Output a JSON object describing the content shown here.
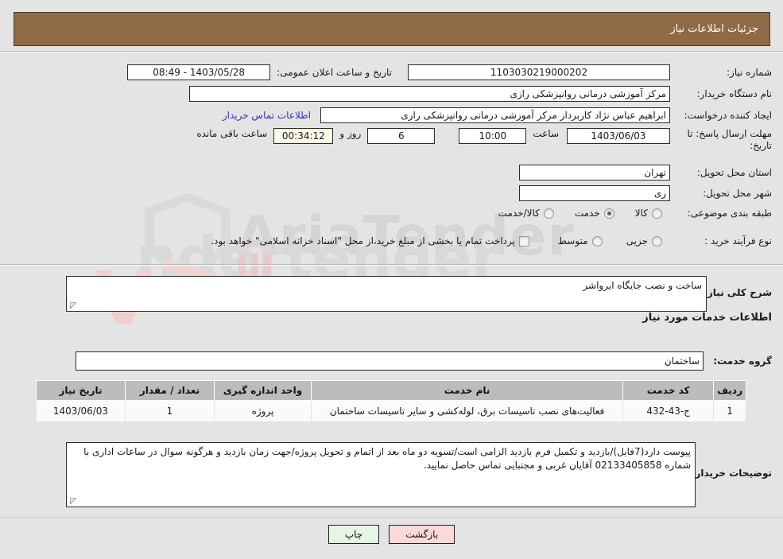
{
  "header": {
    "title": "جزئیات اطلاعات نیاز"
  },
  "watermark": {
    "brand": "AriaTender",
    "tld": ".net",
    "lower": "ndertender"
  },
  "form": {
    "need_number": {
      "label": "شماره نیاز:",
      "value": "1103030219000202"
    },
    "announce_datetime": {
      "label": "تاریخ و ساعت اعلان عمومی:",
      "value": "1403/05/28 - 08:49"
    },
    "buyer_org": {
      "label": "نام دستگاه خریدار:",
      "value": "مرکز آموزشی درمانی روانپزشکی رازی"
    },
    "request_creator": {
      "label": "ایجاد کننده درخواست:",
      "value": "ابراهیم عباس نژاد کاربرداز مرکز آموزشی درمانی روانپزشکی رازی"
    },
    "buyer_contact_link": "اطلاعات تماس خریدار",
    "deadline": {
      "label_line1": "مهلت ارسال پاسخ: تا",
      "label_line2": "تاریخ:",
      "date": "1403/06/03",
      "time_label": "ساعت",
      "time": "10:00",
      "days": "6",
      "days_label": "روز و",
      "countdown": "00:34:12",
      "remaining_label": "ساعت باقی مانده"
    },
    "delivery_province": {
      "label": "استان محل تحویل:",
      "value": "تهران"
    },
    "delivery_city": {
      "label": "شهر محل تحویل:",
      "value": "ری"
    },
    "category": {
      "label": "طبقه بندی موضوعی:",
      "options": [
        "کالا",
        "خدمت",
        "کالا/خدمت"
      ],
      "selected": "خدمت"
    },
    "purchase_type": {
      "label": "نوع فرآیند خرید :",
      "options": [
        "جزیی",
        "متوسط"
      ],
      "selected": ""
    },
    "treasury_note": {
      "text": "پرداخت تمام یا بخشی از مبلغ خرید،از محل \"اسناد خزانه اسلامی\" خواهد بود.",
      "checked": false
    }
  },
  "description": {
    "label": "شرح کلی نیاز:",
    "value": "ساخت و نصب جایگاه ایرواشر"
  },
  "services_section": {
    "heading": "اطلاعات خدمات مورد نیاز",
    "service_group": {
      "label": "گروه خدمت:",
      "value": "ساختمان"
    },
    "table": {
      "columns": [
        "ردیف",
        "کد خدمت",
        "نام خدمت",
        "واحد اندازه گیری",
        "تعداد / مقدار",
        "تاریخ نیاز"
      ],
      "rows": [
        {
          "index": "1",
          "code": "ج-43-432",
          "name": "فعالیت‌های نصب تاسیسات برق، لوله‌کشی و سایر تاسیسات ساختمان",
          "unit": "پروژه",
          "quantity": "1",
          "need_date": "1403/06/03"
        }
      ]
    }
  },
  "buyer_notes": {
    "label": "توضیحات خریدار:",
    "value": "پیوست دارد(7فایل)/بازدید و تکمیل فرم بازدید الزامی است/تسویه دو ماه بعد از اتمام و تحویل پروژه/جهت زمان بازدید و هرگونه سوال در ساعات اداری با شماره 02133405858 آقایان غربی و مجتبایی تماس حاصل نمایید."
  },
  "footer": {
    "print_label": "چاپ",
    "back_label": "بازگشت"
  }
}
